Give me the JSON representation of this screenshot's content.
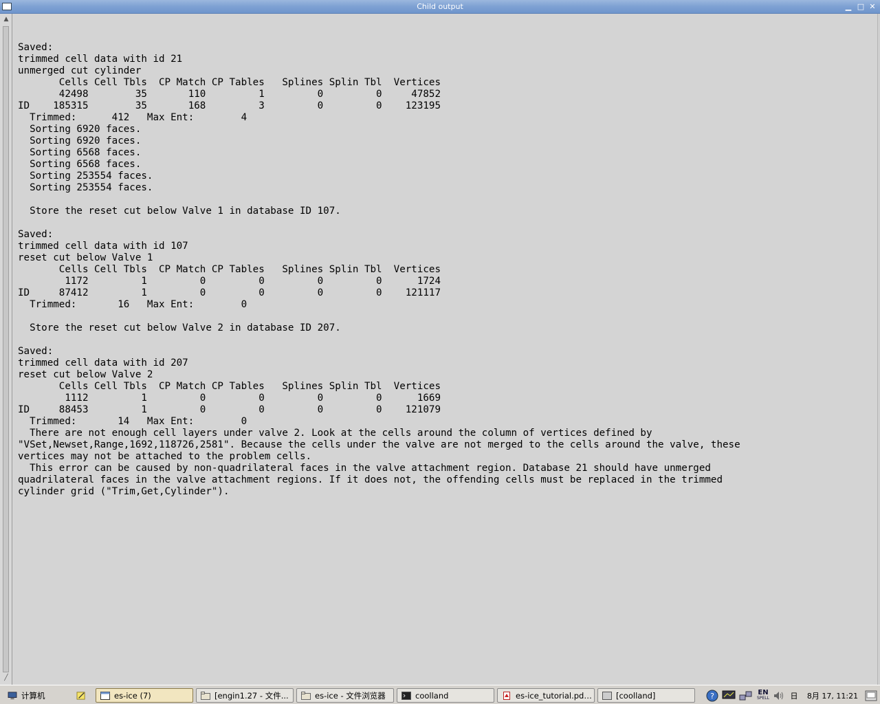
{
  "window": {
    "title": "Child output"
  },
  "output_lines": [
    "",
    "Saved:",
    "trimmed cell data with id 21",
    "unmerged cut cylinder",
    "       Cells Cell Tbls  CP Match CP Tables   Splines Splin Tbl  Vertices",
    "       42498        35       110         1         0         0     47852",
    "ID    185315        35       168         3         0         0    123195",
    "  Trimmed:      412   Max Ent:        4",
    "  Sorting 6920 faces.",
    "  Sorting 6920 faces.",
    "  Sorting 6568 faces.",
    "  Sorting 6568 faces.",
    "  Sorting 253554 faces.",
    "  Sorting 253554 faces.",
    "",
    "  Store the reset cut below Valve 1 in database ID 107.",
    "",
    "Saved:",
    "trimmed cell data with id 107",
    "reset cut below Valve 1",
    "       Cells Cell Tbls  CP Match CP Tables   Splines Splin Tbl  Vertices",
    "        1172         1         0         0         0         0      1724",
    "ID     87412         1         0         0         0         0    121117",
    "  Trimmed:       16   Max Ent:        0",
    "",
    "  Store the reset cut below Valve 2 in database ID 207.",
    "",
    "Saved:",
    "trimmed cell data with id 207",
    "reset cut below Valve 2",
    "       Cells Cell Tbls  CP Match CP Tables   Splines Splin Tbl  Vertices",
    "        1112         1         0         0         0         0      1669",
    "ID     88453         1         0         0         0         0    121079",
    "  Trimmed:       14   Max Ent:        0",
    "  There are not enough cell layers under valve 2. Look at the cells around the column of vertices defined by",
    "\"VSet,Newset,Range,1692,118726,2581\". Because the cells under the valve are not merged to the cells around the valve, these",
    "vertices may not be attached to the problem cells.",
    "  This error can be caused by non-quadrilateral faces in the valve attachment region. Database 21 should have unmerged",
    "quadrilateral faces in the valve attachment regions. If it does not, the offending cells must be replaced in the trimmed",
    "cylinder grid (\"Trim,Get,Cylinder\")."
  ],
  "taskbar": {
    "start_label": "计算机",
    "tasks": [
      {
        "label": "es-ice (7)",
        "icon": "window-icon",
        "active": true
      },
      {
        "label": "[engin1.27 - 文件...",
        "icon": "folder-icon",
        "active": false
      },
      {
        "label": "es-ice - 文件浏览器",
        "icon": "folder-icon",
        "active": false
      },
      {
        "label": "coolland",
        "icon": "terminal-icon",
        "active": false
      },
      {
        "label": "es-ice_tutorial.pdf -···",
        "icon": "pdf-icon",
        "active": false
      },
      {
        "label": "[coolland]",
        "icon": "window-icon",
        "active": false
      }
    ],
    "tray": {
      "lang": "EN",
      "lang_sub": "SPELL",
      "weekday": "日",
      "clock": "8月 17, 11:21"
    }
  },
  "colors": {
    "titlebar": "#7ea1d3",
    "terminal_bg": "#d4d4d4",
    "text": "#000000"
  }
}
